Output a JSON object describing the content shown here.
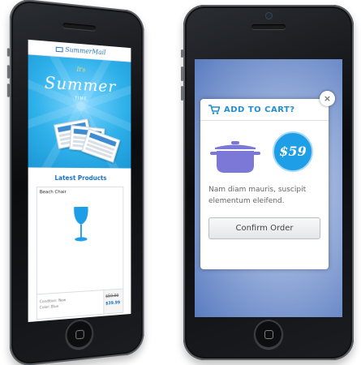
{
  "left_phone": {
    "brand": "SummerMail",
    "hero": {
      "its": "It's",
      "headline": "Summer",
      "sub": "TIME"
    },
    "section_title": "Latest Products",
    "product": {
      "name": "Beach Chair",
      "condition": "Condition: New",
      "color": "Color: Blue",
      "old_price": "$50.00",
      "new_price": "$39.99"
    }
  },
  "right_phone": {
    "popup": {
      "title": "ADD TO CART?",
      "price": "$59",
      "description": "Nam diam mauris, suscipit elementum eleifend.",
      "confirm_label": "Confirm Order",
      "close_label": "×"
    }
  },
  "colors": {
    "accent": "#1e9ee6",
    "pot": "#7b78d8",
    "hero_blue": "#2fb1ea"
  },
  "icons": [
    "cart-icon",
    "pot-icon",
    "close-icon",
    "wine-glass-icon",
    "envelope-icon"
  ]
}
